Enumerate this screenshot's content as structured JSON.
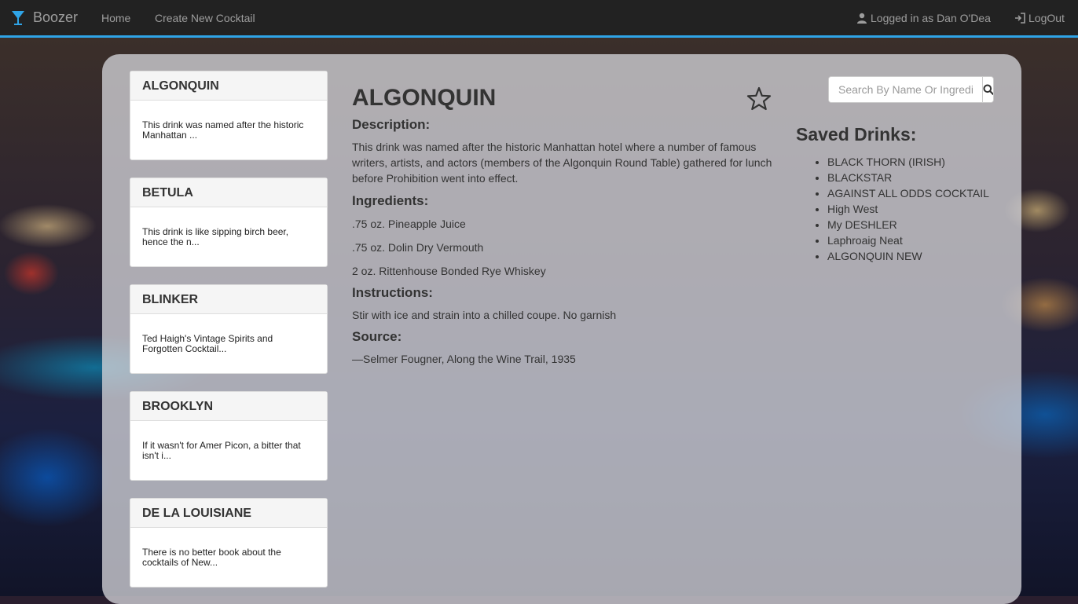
{
  "navbar": {
    "brand": "Boozer",
    "home": "Home",
    "create": "Create New Cocktail",
    "user": "Logged in as Dan O'Dea",
    "logout": "LogOut",
    "accent_color": "#2fa4e7"
  },
  "cards": [
    {
      "title": "ALGONQUIN",
      "snippet": "This drink was named after the historic Manhattan ..."
    },
    {
      "title": "BETULA",
      "snippet": "This drink is like sipping birch beer, hence the n..."
    },
    {
      "title": "BLINKER",
      "snippet": "Ted Haigh's Vintage Spirits and Forgotten Cocktail..."
    },
    {
      "title": "BROOKLYN",
      "snippet": "If it wasn't for Amer Picon, a bitter that isn't i..."
    },
    {
      "title": "DE LA LOUISIANE",
      "snippet": "There is no better book about the cocktails of New..."
    }
  ],
  "detail": {
    "title": "ALGONQUIN",
    "description_heading": "Description:",
    "description": "This drink was named after the historic Manhattan hotel where a number of famous writers, artists, and actors (members of the Algonquin Round Table) gathered for lunch before Prohibition went into effect.",
    "ingredients_heading": "Ingredients:",
    "ingredients": [
      ".75 oz. Pineapple Juice",
      ".75 oz. Dolin Dry Vermouth",
      "2 oz. Rittenhouse Bonded Rye Whiskey"
    ],
    "instructions_heading": "Instructions:",
    "instructions": "Stir with ice and strain into a chilled coupe. No garnish",
    "source_heading": "Source:",
    "source": "—Selmer Fougner, Along the Wine Trail, 1935"
  },
  "search": {
    "placeholder": "Search By Name Or Ingredient"
  },
  "saved": {
    "title": "Saved Drinks:",
    "items": [
      "BLACK THORN (IRISH)",
      "BLACKSTAR",
      "AGAINST ALL ODDS COCKTAIL",
      "High West",
      "My DESHLER",
      "Laphroaig Neat",
      "ALGONQUIN NEW"
    ]
  },
  "icons": [
    "cocktail-glass-icon",
    "user-icon",
    "logout-icon",
    "star-icon",
    "search-icon"
  ]
}
